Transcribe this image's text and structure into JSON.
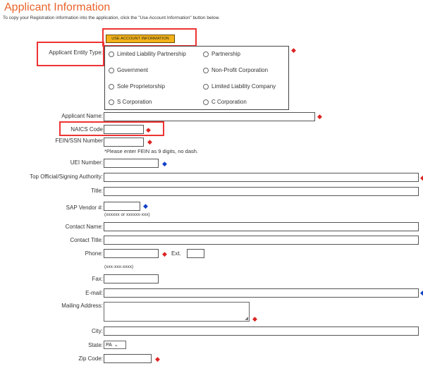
{
  "page": {
    "title": "Applicant Information",
    "intro": "To copy your Registration information into the application, click the \"Use Account Information\" button below."
  },
  "account_button": "USE ACCOUNT INFORMATION",
  "entity": {
    "label": "Applicant Entity Type:",
    "options": [
      "Limited Liability Partnership",
      "Partnership",
      "Government",
      "Non-Profit Corporation",
      "Sole Proprietorship",
      "Limited Liability Company",
      "S Corporation",
      "C Corporation"
    ]
  },
  "fields": {
    "applicant_name": "Applicant Name:",
    "naics_code": "NAICS Code",
    "fein_ssn": "FEIN/SSN Number",
    "fein_note": "*Please enter FEIN as 9 digits, no dash.",
    "uei_number": "UEI Number:",
    "top_official": "Top Official/Signing Authority:",
    "title": "Title:",
    "sap_vendor": "SAP Vendor #:",
    "sap_format": "(xxxxxx or xxxxxx-xxx)",
    "contact_name": "Contact Name:",
    "contact_title": "Contact Title:",
    "phone": "Phone:",
    "ext": "Ext.",
    "phone_format": "(xxx-xxx-xxxx)",
    "fax": "Fax:",
    "email": "E-mail:",
    "mailing_address": "Mailing Address:",
    "city": "City:",
    "state": "State:",
    "state_value": "PA",
    "zip": "Zip Code:"
  },
  "required_marker": "◆",
  "colors": {
    "title": "#e8642a",
    "button": "#f3b21a",
    "required": "#dd2222",
    "optional_marker": "#1340c8",
    "highlight": "#ee3333"
  }
}
